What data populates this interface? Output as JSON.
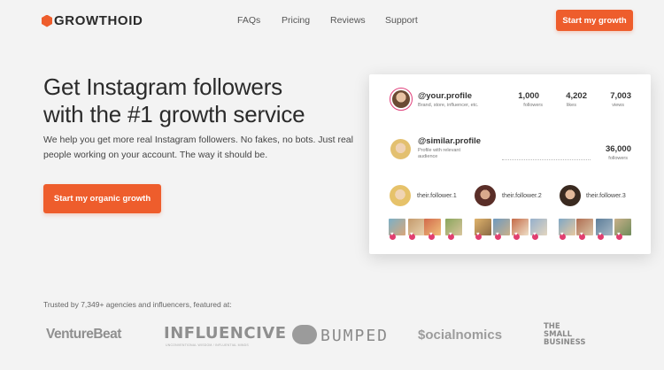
{
  "brand": {
    "name": "GROWTHOID",
    "accent": "#ee5d2c"
  },
  "nav": {
    "items": [
      "FAQs",
      "Pricing",
      "Reviews",
      "Support"
    ],
    "cta": "Start my growth"
  },
  "hero": {
    "headline": [
      "Get Instagram followers",
      "with the #1 growth service"
    ],
    "subtext": [
      "We help you get more real Instagram followers. No fakes, no bots. Just real",
      "people working on your account.  The way it should be."
    ],
    "cta": "Start my organic growth"
  },
  "card": {
    "your_profile": {
      "name": "@your.profile",
      "desc": "Brand, store, influencer, etc.",
      "stats": [
        {
          "value": "1,000",
          "label": "followers"
        },
        {
          "value": "4,202",
          "label": "likes"
        },
        {
          "value": "7,003",
          "label": "views"
        }
      ]
    },
    "similar_profile": {
      "name": "@similar.profile",
      "desc_lines": [
        "Profile with relevant",
        "audience"
      ],
      "followers": "36,000",
      "followers_label": "followers"
    },
    "followers": [
      "their.follower.1",
      "their.follower.2",
      "their.follower.3"
    ]
  },
  "trusted": {
    "text": "Trusted by 7,349+ agencies and influencers, featured at:",
    "press": [
      "VentureBeat",
      "INFLUENCIVE",
      "BUMPED",
      "$ocialnomics",
      "THE SMALL BUSINESS"
    ],
    "influencive_tagline": "UNCONVENTIONAL WISDOM / INFLUENTIAL MINDS"
  }
}
